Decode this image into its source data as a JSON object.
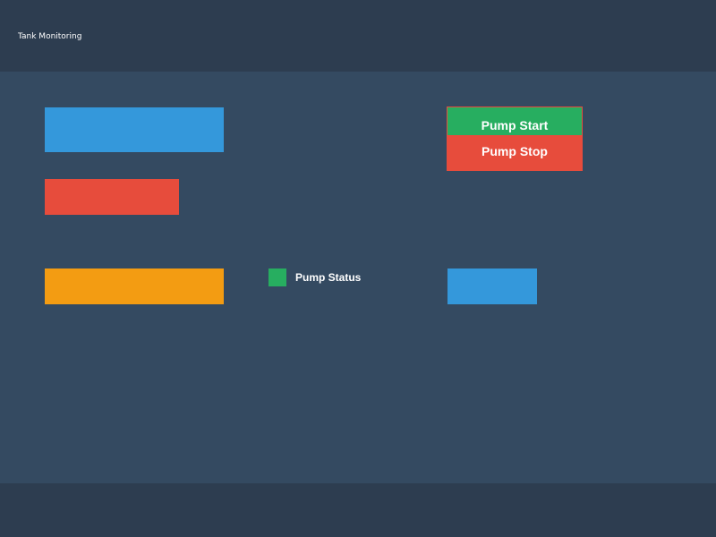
{
  "app": {
    "title": "Tank Monitoring"
  },
  "colors": {
    "background": "#344a61",
    "header_footer": "#2d3d50",
    "blue": "#3498db",
    "red": "#e74c3c",
    "orange": "#f39c12",
    "green": "#27ae60"
  },
  "blocks": [
    {
      "name": "blue-block-top-left",
      "color": "#3498db"
    },
    {
      "name": "red-block-left",
      "color": "#e74c3c"
    },
    {
      "name": "orange-block-left",
      "color": "#f39c12"
    },
    {
      "name": "blue-block-right",
      "color": "#3498db"
    }
  ],
  "pump": {
    "status_label": "Pump Status",
    "status_color": "#27ae60",
    "start_label": "Pump Start",
    "start_color": "#27ae60",
    "stop_label": "Pump Stop",
    "stop_color": "#e74c3c"
  }
}
